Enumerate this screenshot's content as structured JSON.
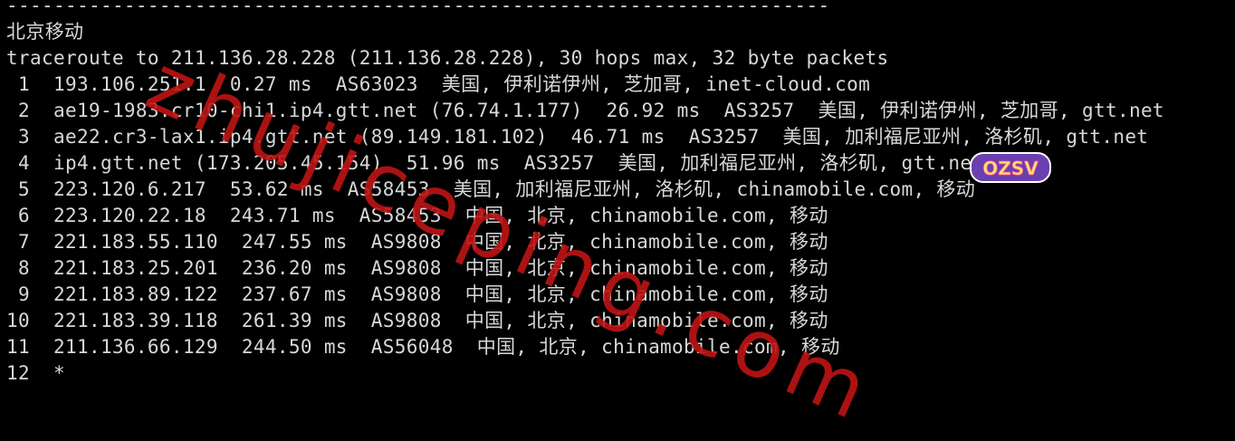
{
  "terminal": {
    "lines": [
      "----------------------------------------------------------------------",
      "北京移动",
      "traceroute to 211.136.28.228 (211.136.28.228), 30 hops max, 32 byte packets",
      " 1  193.106.251.1  0.27 ms  AS63023  美国, 伊利诺伊州, 芝加哥, inet-cloud.com",
      " 2  ae19-1983.cr10-chi1.ip4.gtt.net (76.74.1.177)  26.92 ms  AS3257  美国, 伊利诺伊州, 芝加哥, gtt.net",
      " 3  ae22.cr3-lax1.ip4.gtt.net (89.149.181.102)  46.71 ms  AS3257  美国, 加利福尼亚州, 洛杉矶, gtt.net",
      " 4  ip4.gtt.net (173.205.45.154)  51.96 ms  AS3257  美国, 加利福尼亚州, 洛杉矶, gtt.net",
      " 5  223.120.6.217  53.62 ms  AS58453  美国, 加利福尼亚州, 洛杉矶, chinamobile.com, 移动",
      " 6  223.120.22.18  243.71 ms  AS58453  中国, 北京, chinamobile.com, 移动",
      " 7  221.183.55.110  247.55 ms  AS9808  中国, 北京, chinamobile.com, 移动",
      " 8  221.183.25.201  236.20 ms  AS9808  中国, 北京, chinamobile.com, 移动",
      " 9  221.183.89.122  237.67 ms  AS9808  中国, 北京, chinamobile.com, 移动",
      "10  221.183.39.118  261.39 ms  AS9808  中国, 北京, chinamobile.com, 移动",
      "11  211.136.66.129  244.50 ms  AS56048  中国, 北京, chinamobile.com, 移动",
      "12  *"
    ]
  },
  "watermark": {
    "text": "zhujiceping.com",
    "logo_text": "OZSV",
    "color": "#be1414"
  },
  "colors": {
    "background": "#000000",
    "foreground": "#d8d8d8"
  }
}
